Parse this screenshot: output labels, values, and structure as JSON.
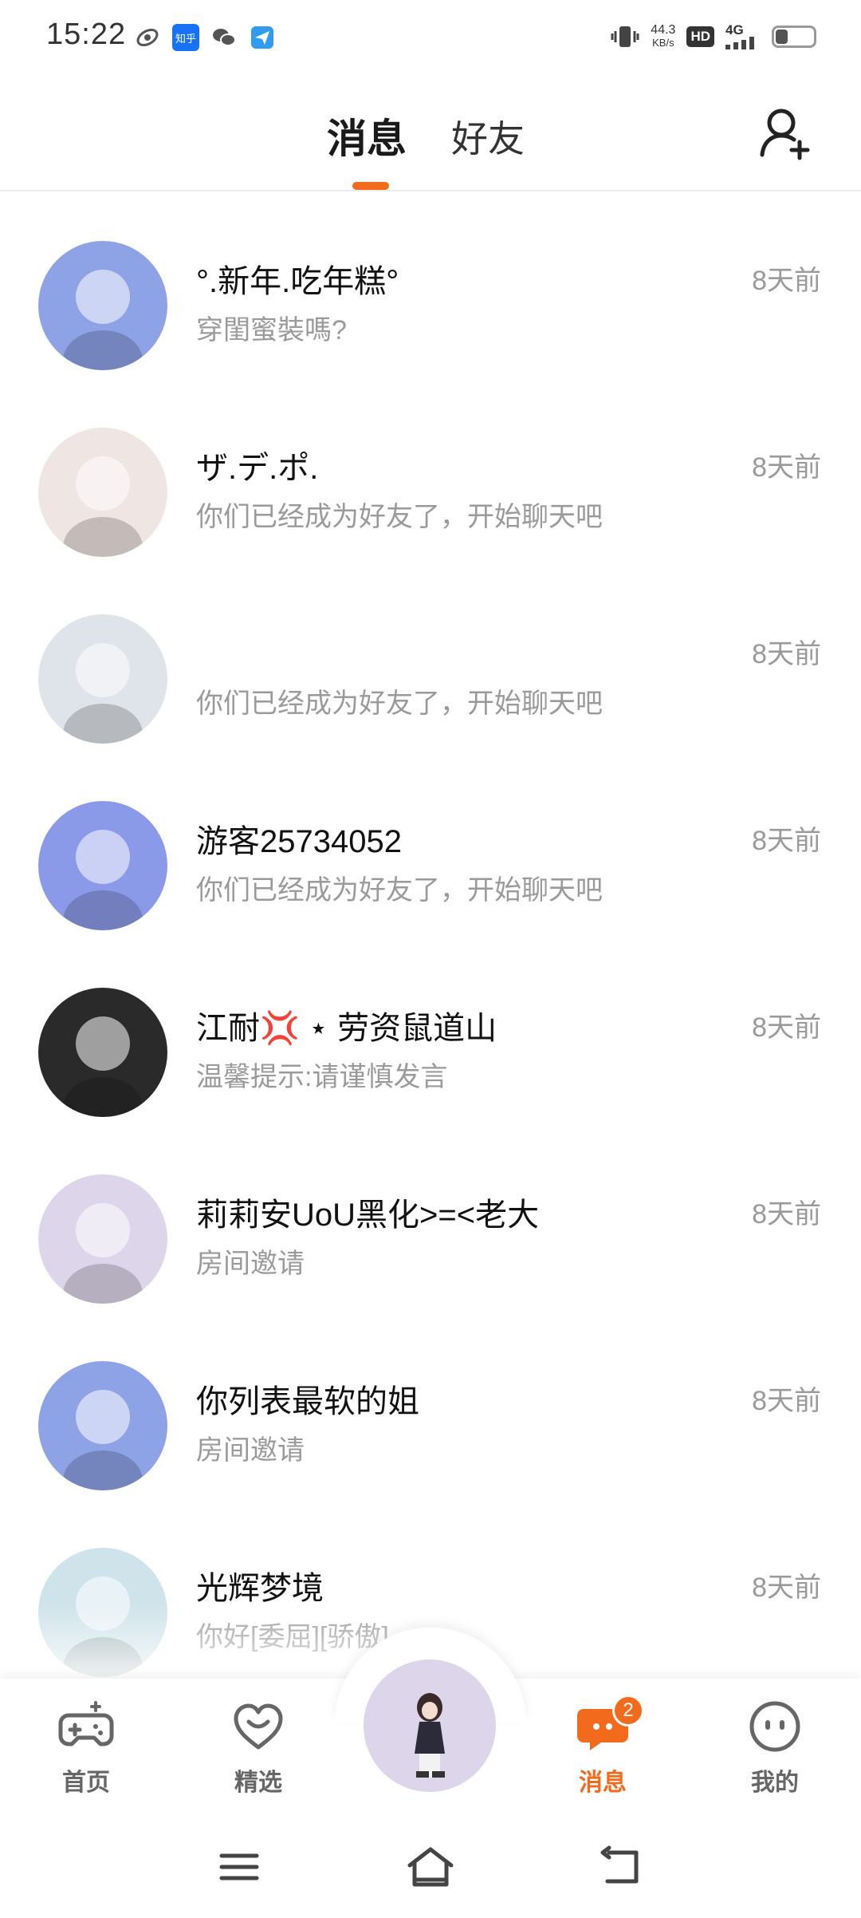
{
  "status_bar": {
    "time": "15:22",
    "net_speed_value": "44.3",
    "net_speed_unit": "KB/s",
    "hd_label": "HD",
    "signal_label": "4G",
    "zhihu_label": "知乎",
    "battery_level": 0.3
  },
  "header": {
    "tabs": [
      {
        "label": "消息",
        "active": true
      },
      {
        "label": "好友",
        "active": false
      }
    ],
    "accent_color": "#f26b1d"
  },
  "messages": [
    {
      "name": "°.新年.吃年糕°",
      "preview": "穿閨蜜裝嗎?",
      "time": "8天前",
      "avatar_color": "#8ea2e6"
    },
    {
      "name": "ザ.デ.ポ.",
      "preview": "你们已经成为好友了，开始聊天吧",
      "time": "8天前",
      "avatar_color": "#efe5e2"
    },
    {
      "name": "",
      "preview": "你们已经成为好友了，开始聊天吧",
      "time": "8天前",
      "avatar_color": "#dfe3ea"
    },
    {
      "name": "游客25734052",
      "preview": "你们已经成为好友了，开始聊天吧",
      "time": "8天前",
      "avatar_color": "#8b9ae8"
    },
    {
      "name": "江耐💢 ⋆ 劳资鼠道山",
      "preview": "温馨提示:请谨慎发言",
      "time": "8天前",
      "avatar_color": "#2a2a2a"
    },
    {
      "name": "莉莉安UoU黑化>=<老大",
      "preview": "房间邀请",
      "time": "8天前",
      "avatar_color": "#ddd6ea"
    },
    {
      "name": "你列表最软的姐",
      "preview": "房间邀请",
      "time": "8天前",
      "avatar_color": "#8ea2e6"
    },
    {
      "name": "光辉梦境",
      "preview": "你好[委屈][骄傲]",
      "time": "8天前",
      "avatar_color": "#cfe3ea"
    }
  ],
  "tabbar": {
    "items": [
      {
        "label": "首页",
        "icon": "gamepad-icon",
        "active": false
      },
      {
        "label": "精选",
        "icon": "heart-chat-icon",
        "active": false
      },
      {
        "label": "消息",
        "icon": "message-icon",
        "active": true
      },
      {
        "label": "我的",
        "icon": "face-icon",
        "active": false
      }
    ],
    "message_badge": "2"
  },
  "navbar": {
    "buttons": [
      "menu-icon",
      "home-icon",
      "back-icon"
    ]
  }
}
